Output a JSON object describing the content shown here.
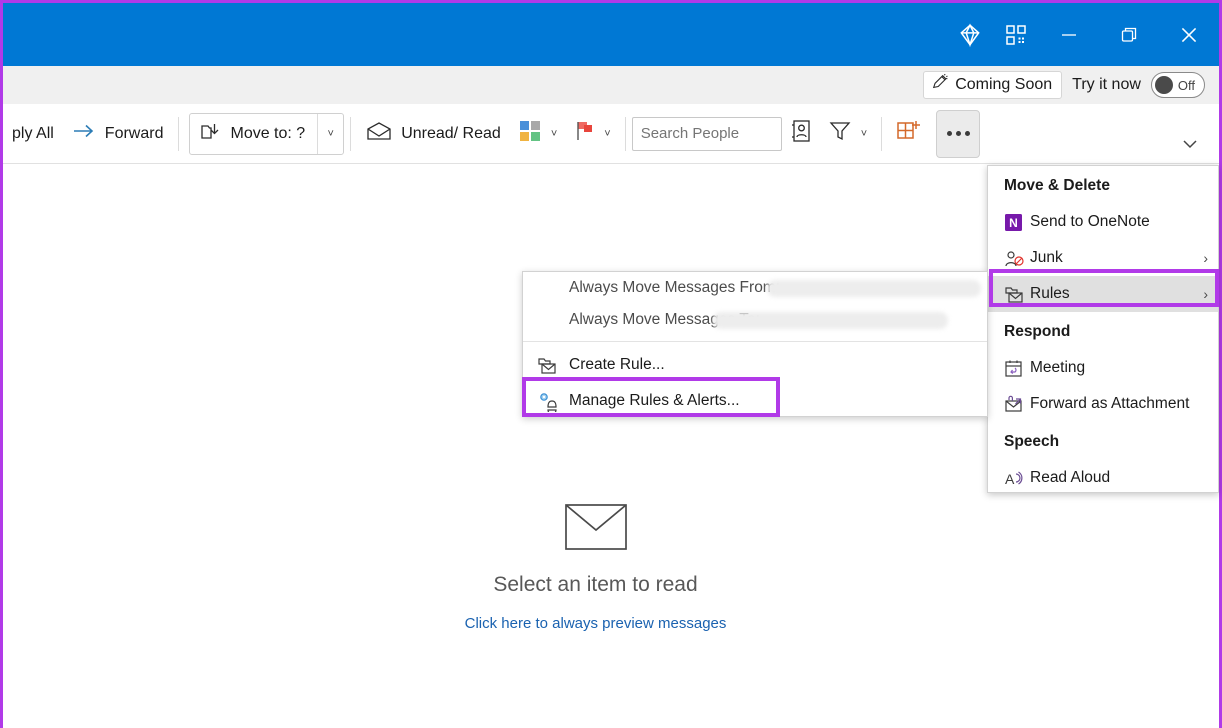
{
  "titlebar": {
    "icons": [
      {
        "name": "diamond-icon",
        "label": "Diamond"
      },
      {
        "name": "qr-code-icon",
        "label": "QR code"
      },
      {
        "name": "minimize-button",
        "label": "Minimize"
      },
      {
        "name": "restore-button",
        "label": "Restore Down"
      },
      {
        "name": "close-button",
        "label": "Close"
      }
    ],
    "background": "#0078d4"
  },
  "coming_soon_bar": {
    "pill_label": "Coming Soon",
    "pill_icon": "pen-announce-icon",
    "try_label": "Try it now",
    "toggle_state": "Off"
  },
  "toolbar": {
    "reply_all_label": "ply All",
    "forward_label": "Forward",
    "move_to_label": "Move to: ?",
    "unread_read_label": "Unread/ Read",
    "categorize_icon": "categorize-icon",
    "flag_icon": "flag-icon",
    "search_placeholder": "Search People",
    "address_book_icon": "address-book-icon",
    "filter_icon": "filter-funnel-icon",
    "addins_icon": "get-addins-icon",
    "more_label": "More commands",
    "ribbon_expand_icon": "chevron-down-icon"
  },
  "reading_pane": {
    "empty_icon": "envelope-icon",
    "empty_title": "Select an item to read",
    "preview_link": "Click here to always preview messages"
  },
  "context_menu": {
    "sections": [
      {
        "header": "Move & Delete",
        "items": [
          {
            "label": "Send to OneNote",
            "icon": "onenote-icon",
            "underline": "N",
            "submenu": false,
            "highlighted": false
          },
          {
            "label": "Junk",
            "icon": "junk-person-icon",
            "underline": "J",
            "submenu": true,
            "highlighted": false
          },
          {
            "label": "Rules",
            "icon": "rules-folder-icon",
            "underline": "s",
            "submenu": true,
            "highlighted": true
          }
        ]
      },
      {
        "header": "Respond",
        "items": [
          {
            "label": "Meeting",
            "icon": "meeting-calendar-icon",
            "underline": "M",
            "submenu": false,
            "highlighted": false
          },
          {
            "label": "Forward as Attachment",
            "icon": "forward-attachment-icon",
            "underline": "F",
            "submenu": false,
            "highlighted": false
          }
        ]
      },
      {
        "header": "Speech",
        "items": [
          {
            "label": "Read Aloud",
            "icon": "read-aloud-icon",
            "underline": "R",
            "submenu": false,
            "highlighted": false
          }
        ]
      }
    ]
  },
  "rules_submenu": {
    "always_move_from_label": "Always Move Messages From:",
    "always_move_to_label": "Always Move Messages To:",
    "create_rule_label": "Create Rule...",
    "create_rule_icon": "create-rule-icon",
    "manage_rules_label": "Manage Rules & Alerts...",
    "manage_rules_icon": "manage-rules-gear-bell-icon"
  },
  "annotations": {
    "highlight_color": "#b13ae8",
    "border_color": "#b13ae8",
    "highlighted_items": [
      "Rules",
      "Manage Rules & Alerts..."
    ]
  }
}
